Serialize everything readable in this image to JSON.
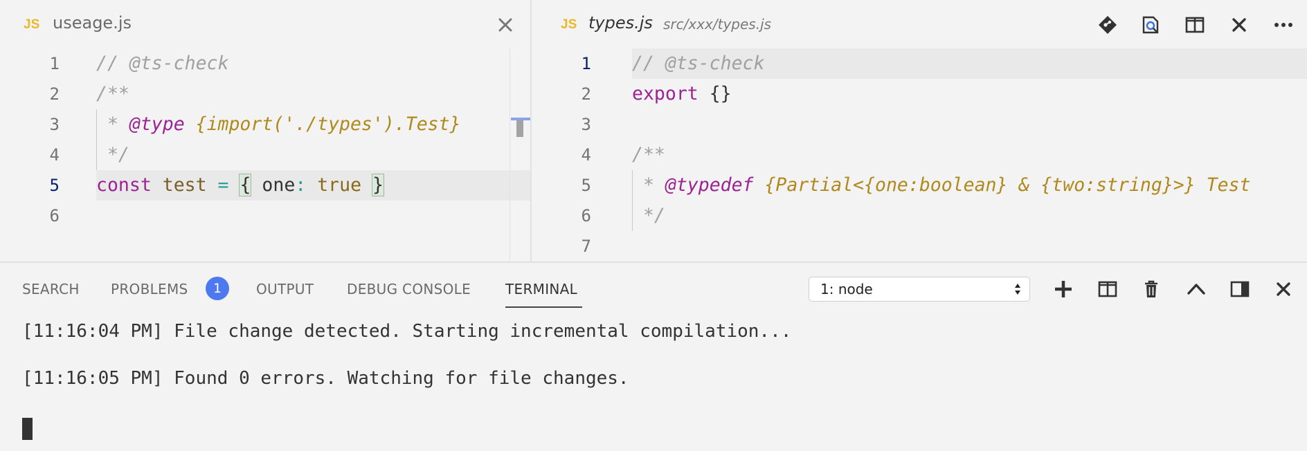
{
  "editor_left": {
    "tab": {
      "badge": "JS",
      "title": "useage.js"
    },
    "icons": {
      "close": "close-icon"
    },
    "line_numbers": [
      "1",
      "2",
      "3",
      "4",
      "5",
      "6"
    ],
    "lines": [
      {
        "tokens": [
          {
            "t": "// @ts-check",
            "c": "comment"
          }
        ]
      },
      {
        "tokens": [
          {
            "t": "/**",
            "c": "comment"
          }
        ]
      },
      {
        "tokens": [
          {
            "t": " * ",
            "c": "comment"
          },
          {
            "t": "@type",
            "c": "doctag"
          },
          {
            "t": " {import('./types').Test}",
            "c": "doctype"
          }
        ]
      },
      {
        "tokens": [
          {
            "t": " */",
            "c": "comment"
          }
        ]
      },
      {
        "tokens": [
          {
            "t": "const",
            "c": "kw"
          },
          {
            "t": " ",
            "c": ""
          },
          {
            "t": "test",
            "c": "fn"
          },
          {
            "t": " ",
            "c": ""
          },
          {
            "t": "=",
            "c": "op"
          },
          {
            "t": " ",
            "c": ""
          },
          {
            "t": "{",
            "c": "br"
          },
          {
            "t": " one",
            "c": "prop"
          },
          {
            "t": ":",
            "c": "op"
          },
          {
            "t": " ",
            "c": ""
          },
          {
            "t": "true",
            "c": "bool"
          },
          {
            "t": " ",
            "c": ""
          },
          {
            "t": "}",
            "c": "br"
          }
        ]
      },
      {
        "tokens": []
      }
    ]
  },
  "editor_right": {
    "tab": {
      "badge": "JS",
      "title": "types.js",
      "description": "src/xxx/types.js"
    },
    "icons": {
      "git": "git-compare-icon",
      "search": "open-preview-icon",
      "split": "split-editor-icon",
      "close": "close-icon",
      "more": "more-actions-icon"
    },
    "line_numbers": [
      "1",
      "2",
      "3",
      "4",
      "5",
      "6",
      "7"
    ],
    "lines": [
      {
        "tokens": [
          {
            "t": "// @ts-check",
            "c": "comment"
          }
        ]
      },
      {
        "tokens": [
          {
            "t": "export",
            "c": "kw"
          },
          {
            "t": " {}",
            "c": "prop"
          }
        ]
      },
      {
        "tokens": []
      },
      {
        "tokens": [
          {
            "t": "/**",
            "c": "comment"
          }
        ]
      },
      {
        "tokens": [
          {
            "t": " * ",
            "c": "comment"
          },
          {
            "t": "@typedef",
            "c": "doctag"
          },
          {
            "t": " {Partial<{one:boolean} & {two:string}>} Test",
            "c": "doctype"
          }
        ]
      },
      {
        "tokens": [
          {
            "t": " */",
            "c": "comment"
          }
        ]
      },
      {
        "tokens": []
      }
    ]
  },
  "panel": {
    "tabs": {
      "search": "SEARCH",
      "problems": "PROBLEMS",
      "output": "OUTPUT",
      "debug_console": "DEBUG CONSOLE",
      "terminal": "TERMINAL"
    },
    "problems_count": "1",
    "terminal_select": "1: node",
    "icons": {
      "add": "plus-icon",
      "split": "split-terminal-icon",
      "kill": "trash-icon",
      "maximize": "chevron-up-icon",
      "layout": "panel-layout-icon",
      "close": "close-icon"
    },
    "terminal_lines": [
      "[11:16:04 PM] File change detected. Starting incremental compilation...",
      "[11:16:05 PM] Found 0 errors. Watching for file changes."
    ]
  }
}
